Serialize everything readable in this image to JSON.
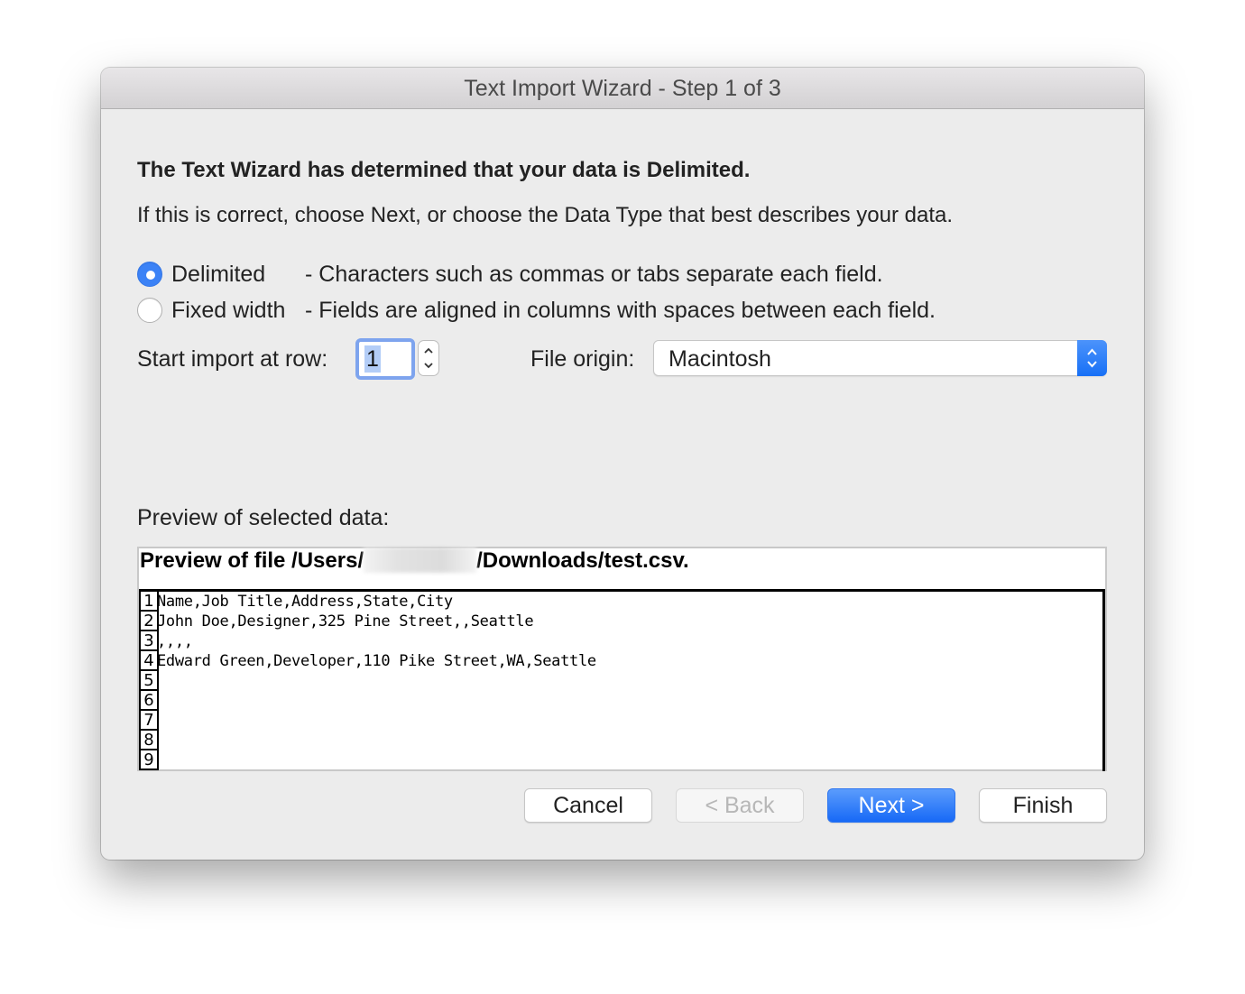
{
  "window": {
    "title": "Text Import Wizard - Step 1 of 3"
  },
  "heading": "The Text Wizard has determined that your data is Delimited.",
  "instructions": "If this is correct, choose Next, or choose the Data Type that best describes your data.",
  "data_type": {
    "options": [
      {
        "label": "Delimited",
        "description": "- Characters such as commas or tabs separate each field.",
        "selected": true
      },
      {
        "label": "Fixed width",
        "description": "- Fields are aligned in columns with spaces between each field.",
        "selected": false
      }
    ]
  },
  "start_row": {
    "label": "Start import at row:",
    "value": "1"
  },
  "file_origin": {
    "label": "File origin:",
    "value": "Macintosh"
  },
  "preview": {
    "label": "Preview of selected data:",
    "title_prefix": "Preview of file /Users/",
    "title_suffix": "/Downloads/test.csv.",
    "lines": [
      {
        "n": "1",
        "text": "Name,Job Title,Address,State,City"
      },
      {
        "n": "2",
        "text": "John Doe,Designer,325 Pine Street,,Seattle"
      },
      {
        "n": "3",
        "text": ",,,,"
      },
      {
        "n": "4",
        "text": "Edward Green,Developer,110 Pike Street,WA,Seattle"
      },
      {
        "n": "5",
        "text": ""
      },
      {
        "n": "6",
        "text": ""
      },
      {
        "n": "7",
        "text": ""
      },
      {
        "n": "8",
        "text": ""
      },
      {
        "n": "9",
        "text": ""
      }
    ]
  },
  "buttons": {
    "cancel": "Cancel",
    "back": "< Back",
    "next": "Next >",
    "finish": "Finish"
  },
  "colors": {
    "accent": "#1a73f7",
    "selection": "#b3cdf7"
  }
}
